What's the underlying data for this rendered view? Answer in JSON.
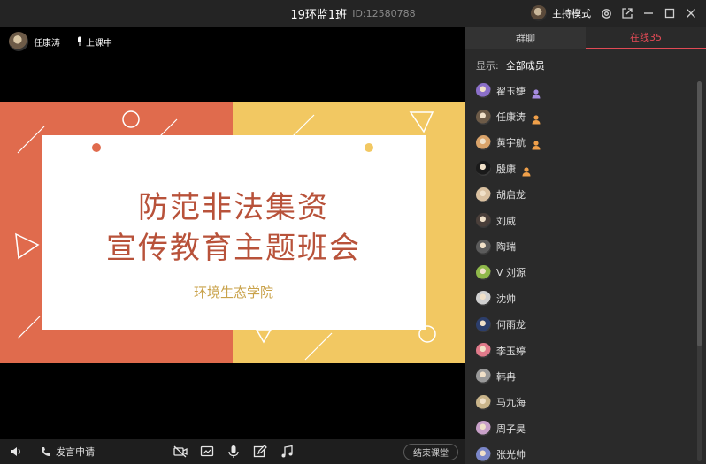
{
  "window": {
    "title": "19环监1班",
    "room_id": "ID:12580788",
    "host_mode_label": "主持模式"
  },
  "video": {
    "teacher_name": "任康涛",
    "status": "上课中"
  },
  "slide": {
    "title_line1": "防范非法集资",
    "title_line2": "宣传教育主题班会",
    "subtitle": "环境生态学院",
    "colors": {
      "left": "#e06b4d",
      "right": "#f2c862",
      "title": "#b8523a"
    }
  },
  "toolbar": {
    "apply_label": "发言申请",
    "end_label": "结束课堂"
  },
  "panel": {
    "tabs": [
      {
        "label": "群聊",
        "active": false
      },
      {
        "label": "在线35",
        "active": true
      }
    ],
    "filter_label": "显示:",
    "filter_value": "全部成员",
    "members": [
      {
        "name": "翟玉婕",
        "avatar": "#8b6fc9",
        "badge": "teacher-purple"
      },
      {
        "name": "任康涛",
        "avatar": "#6d5b48",
        "badge": "teacher-orange"
      },
      {
        "name": "黄宇航",
        "avatar": "#d9a36a",
        "badge": "teacher-orange"
      },
      {
        "name": "殷康",
        "avatar": "#1a1a1a",
        "badge": "teacher-orange"
      },
      {
        "name": "胡启龙",
        "avatar": "#d9c0a0",
        "badge": ""
      },
      {
        "name": "刘威",
        "avatar": "#4a3f3a",
        "badge": ""
      },
      {
        "name": "陶瑞",
        "avatar": "#5b5b5b",
        "badge": ""
      },
      {
        "name": "V  刘源",
        "avatar": "#8fb84a",
        "badge": ""
      },
      {
        "name": "沈帅",
        "avatar": "#d0d0d0",
        "badge": ""
      },
      {
        "name": "何雨龙",
        "avatar": "#2c3e6b",
        "badge": ""
      },
      {
        "name": "李玉婷",
        "avatar": "#e07a8a",
        "badge": ""
      },
      {
        "name": "韩冉",
        "avatar": "#9a9a9a",
        "badge": ""
      },
      {
        "name": "马九海",
        "avatar": "#c9b48a",
        "badge": ""
      },
      {
        "name": "周子昊",
        "avatar": "#c8a0c8",
        "badge": ""
      },
      {
        "name": "张光帅",
        "avatar": "#7a86c8",
        "badge": ""
      }
    ]
  },
  "colors": {
    "accent": "#e24a55"
  }
}
